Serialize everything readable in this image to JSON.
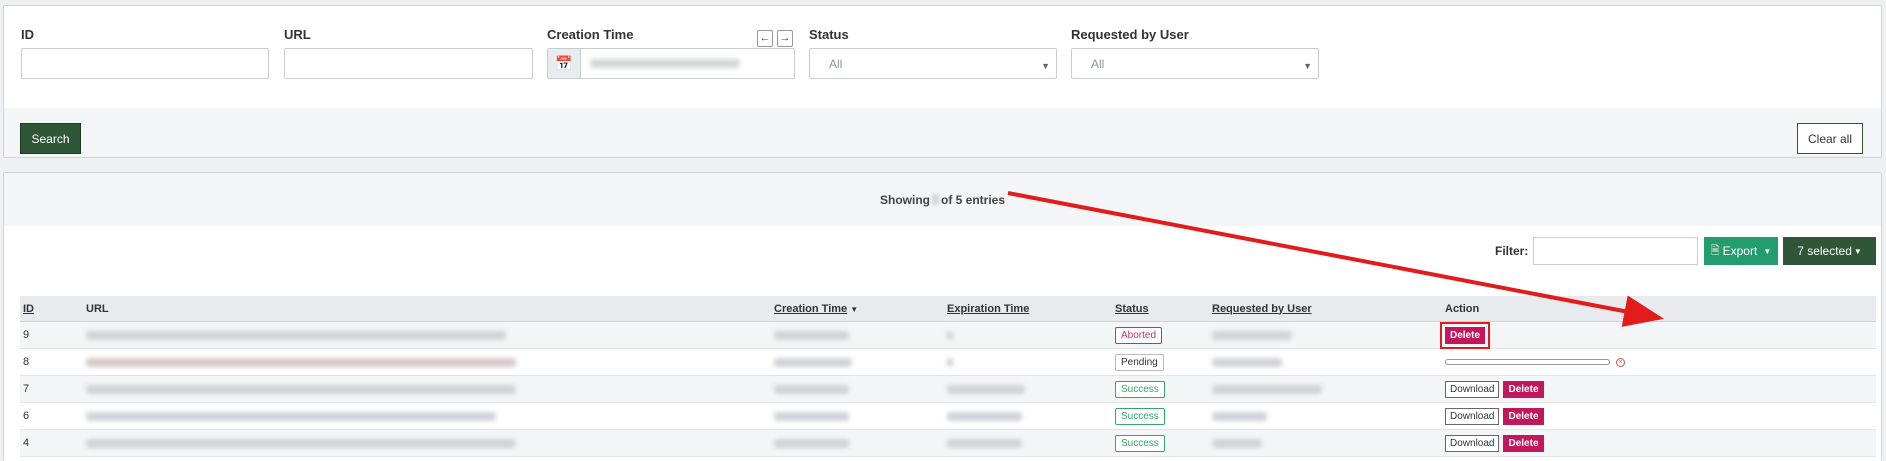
{
  "filters": {
    "id_label": "ID",
    "url_label": "URL",
    "creation_time_label": "Creation Time",
    "prev_icon": "←",
    "next_icon": "→",
    "status_label": "Status",
    "status_value": "All",
    "requested_label": "Requested by User",
    "requested_value": "All",
    "search_label": "Search",
    "clear_label": "Clear all"
  },
  "results": {
    "showing_prefix": "Showing",
    "showing_suffix": "of 5 entries",
    "filter_label": "Filter:",
    "export_label": "Export",
    "selected_label": "7 selected"
  },
  "table": {
    "headers": {
      "id": "ID",
      "url": "URL",
      "creation_time": "Creation Time",
      "expiration_time": "Expiration Time",
      "status": "Status",
      "requested_by": "Requested by User",
      "action": "Action"
    },
    "rows": [
      {
        "id": "9",
        "status": "Aborted",
        "actions": [
          "Delete"
        ]
      },
      {
        "id": "8",
        "status": "Pending",
        "actions": []
      },
      {
        "id": "7",
        "status": "Success",
        "actions": [
          "Download",
          "Delete"
        ]
      },
      {
        "id": "6",
        "status": "Success",
        "actions": [
          "Download",
          "Delete"
        ]
      },
      {
        "id": "4",
        "status": "Success",
        "actions": [
          "Download",
          "Delete"
        ]
      }
    ]
  },
  "labels": {
    "download": "Download",
    "delete": "Delete"
  },
  "colors": {
    "primary": "#2f5637",
    "export": "#239c6e",
    "delete": "#c2185b",
    "annotation_arrow": "#e21b1b"
  }
}
